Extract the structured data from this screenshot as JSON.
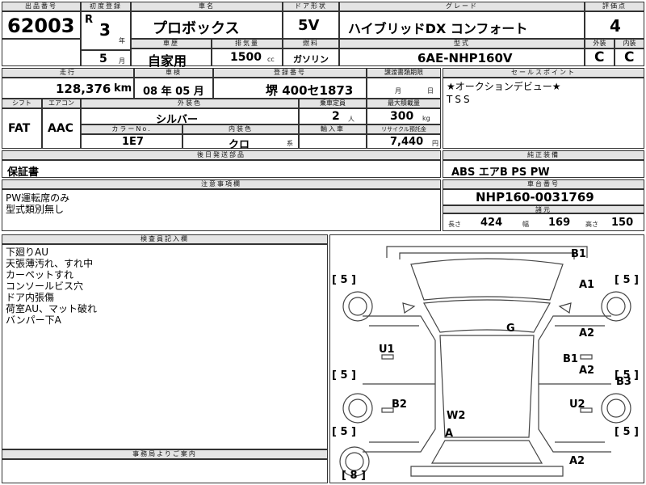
{
  "header_labels": {
    "lot_number": "出品番号",
    "first_reg": "初度登録",
    "car_name": "車名",
    "door_shape": "ドア形状",
    "grade": "グレード",
    "score": "評価点",
    "history": "車歴",
    "displacement": "排気量",
    "fuel": "燃料",
    "model_code": "型式",
    "exterior": "外装",
    "interior": "内装",
    "mileage": "走行",
    "inspection": "車検",
    "plate": "登録番号",
    "transfer_deadline": "譲渡書類期限",
    "shift": "シフト",
    "ac": "エアコン",
    "ext_color": "外装色",
    "capacity": "乗車定員",
    "max_load": "最大積載量",
    "color_no": "カラーNo.",
    "int_color": "内装色",
    "import": "輸入車",
    "recycle": "リサイクル預託金",
    "later_shipping": "後日発送部品",
    "notes": "注意事項欄",
    "selling_points": "セールスポイント",
    "equipment": "純正装備",
    "chassis_no": "車台番号",
    "dimensions": "諸元",
    "inspector_notes": "検査員記入欄",
    "office_notice": "事務局よりご案内"
  },
  "lot_number": "62003",
  "first_reg": {
    "era": "R",
    "year": "3",
    "year_unit": "年",
    "month": "5",
    "month_unit": "月"
  },
  "car_name": "プロボックス",
  "door_shape": "5V",
  "grade": "ハイブリッドDX コンフォート",
  "score": "4",
  "history": "自家用",
  "displacement": "1500",
  "displacement_unit": "cc",
  "fuel": "ガソリン",
  "model_code": "6AE-NHP160V",
  "exterior_grade": "C",
  "interior_grade": "C",
  "mileage": "128,376",
  "mileage_unit": "km",
  "inspection": "08 年 05 月",
  "plate": "堺 400セ1873",
  "transfer_month": "月",
  "transfer_day": "日",
  "shift": "FAT",
  "ac": "AAC",
  "ext_color": "シルバー",
  "capacity": "2",
  "capacity_unit": "人",
  "max_load": "300",
  "max_load_unit": "kg",
  "color_no": "1E7",
  "int_color": "クロ",
  "int_color_unit": "系",
  "recycle": "7,440",
  "recycle_unit": "円",
  "later_shipping": "保証書",
  "equipment": "ABS エアB PS PW",
  "notes": [
    "PW運転席のみ",
    "型式類別無し"
  ],
  "selling_points": [
    "★オークションデビュー★",
    "TSS"
  ],
  "chassis_no": "NHP160-0031769",
  "dims": {
    "len_label": "長さ",
    "len": "424",
    "width_label": "幅",
    "width": "169",
    "height_label": "高さ",
    "height": "150"
  },
  "inspector_notes": [
    "下廻りAU",
    "天張薄汚れ、すれ中",
    "カーペットすれ",
    "コンソールビス穴",
    "ドア内張傷",
    "荷室AU、マット破れ",
    "バンパー下A"
  ],
  "diagram": {
    "labels": [
      "B1",
      "A1",
      "G",
      "A2",
      "U1",
      "B1",
      "A2",
      "B3",
      "B2",
      "U2",
      "W2",
      "A",
      "A2"
    ],
    "tire_marks": [
      "5",
      "5",
      "5",
      "5",
      "5",
      "5",
      "8"
    ]
  }
}
